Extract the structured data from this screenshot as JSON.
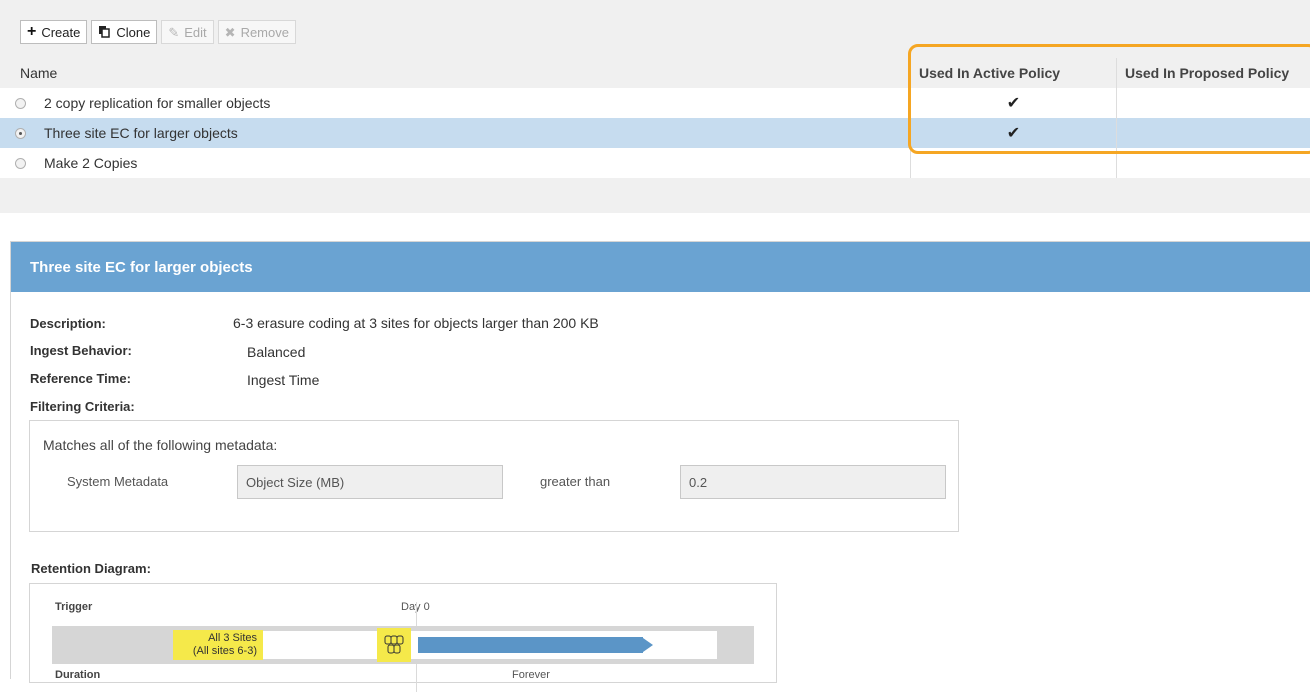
{
  "toolbar": {
    "create_label": "Create",
    "clone_label": "Clone",
    "edit_label": "Edit",
    "remove_label": "Remove"
  },
  "table": {
    "columns": {
      "name": "Name",
      "active": "Used In Active Policy",
      "proposed": "Used In Proposed Policy"
    },
    "rows": [
      {
        "name": "2 copy replication for smaller objects",
        "active": "✔",
        "proposed": "",
        "selected": false
      },
      {
        "name": "Three site EC for larger objects",
        "active": "✔",
        "proposed": "",
        "selected": true
      },
      {
        "name": "Make 2 Copies",
        "active": "",
        "proposed": "",
        "selected": false
      }
    ]
  },
  "details": {
    "title": "Three site EC for larger objects",
    "description_label": "Description:",
    "description_value": "6-3 erasure coding at 3 sites for objects larger than 200 KB",
    "ingest_label": "Ingest Behavior:",
    "ingest_value": "Balanced",
    "reference_label": "Reference Time:",
    "reference_value": "Ingest Time",
    "filtering_label": "Filtering Criteria:",
    "filter": {
      "title": "Matches all of the following metadata:",
      "metadata_type": "System Metadata",
      "field": "Object Size (MB)",
      "operator": "greater than",
      "value": "0.2"
    },
    "retention_label": "Retention Diagram:",
    "diagram": {
      "trigger_label": "Trigger",
      "day_label": "Day 0",
      "sites_line1": "All 3 Sites",
      "sites_line2": "(All sites 6-3)",
      "duration_label": "Duration",
      "duration_value": "Forever"
    }
  },
  "colors": {
    "accent_header": "#6aa3d2",
    "selected_row": "#c6dcef",
    "highlight_box": "#f5a623",
    "highlight_yellow": "#f5e94a",
    "retention_bar": "#5b95c7"
  }
}
